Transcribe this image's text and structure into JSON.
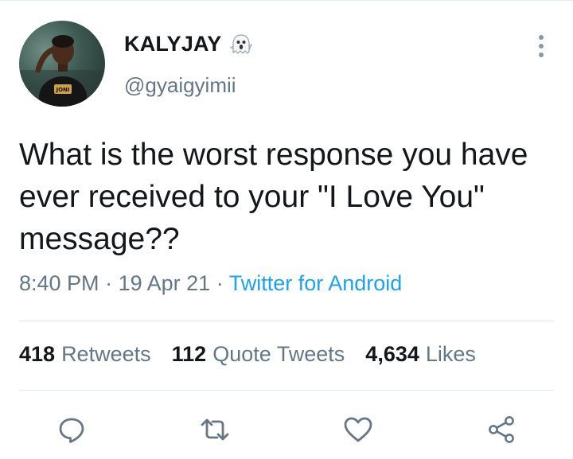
{
  "tweet": {
    "author": {
      "display_name": "KALYJAY",
      "handle": "@gyaigyimii",
      "name_emoji_icon": "ghost-emoji-icon",
      "avatar_shirt_text": "JONI"
    },
    "text": "What is the worst response you have ever received to your \"I Love You\" message??",
    "time": "8:40 PM",
    "separator": "·",
    "date": "19 Apr 21",
    "source": "Twitter for Android",
    "stats": {
      "retweets_count": "418",
      "retweets_label": "Retweets",
      "quote_tweets_count": "112",
      "quote_tweets_label": "Quote Tweets",
      "likes_count": "4,634",
      "likes_label": "Likes"
    },
    "actions": [
      "reply-icon",
      "retweet-icon",
      "like-icon",
      "share-icon"
    ]
  },
  "colors": {
    "text_primary": "#14171a",
    "text_secondary": "#657786",
    "link": "#1da1f2",
    "icon": "#657786",
    "divider": "#e1e8ed"
  }
}
